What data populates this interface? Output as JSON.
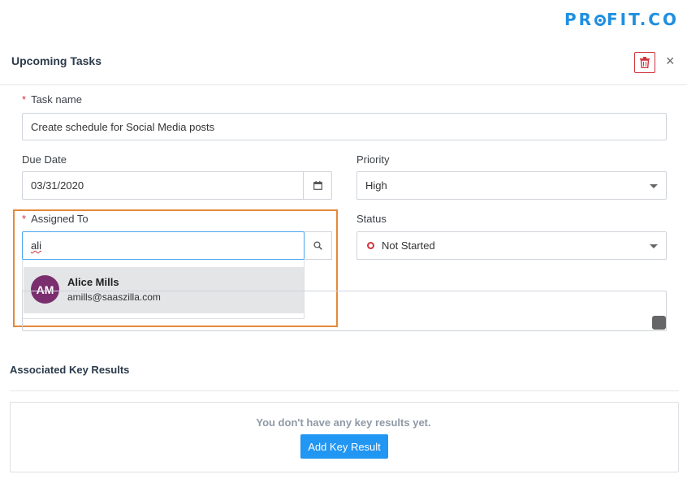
{
  "brand": {
    "logo_pre": "PR",
    "logo_post": "FIT.CO",
    "color": "#1f8fe0"
  },
  "header": {
    "title": "Upcoming Tasks",
    "delete_icon": "trash-icon",
    "close_label": "×"
  },
  "task_name": {
    "label": "Task name",
    "required": "*",
    "value": "Create schedule for Social Media posts"
  },
  "due_date": {
    "label": "Due Date",
    "value": "03/31/2020",
    "icon": "calendar-icon"
  },
  "priority": {
    "label": "Priority",
    "value": "High"
  },
  "assigned_to": {
    "label": "Assigned To",
    "required": "*",
    "query": "ali",
    "icon": "search-icon",
    "results": [
      {
        "initials": "AM",
        "name": "Alice Mills",
        "email": "amills@saaszilla.com",
        "avatar_color": "#7a2e6e"
      }
    ]
  },
  "status": {
    "label": "Status",
    "value": "Not Started",
    "dot_color": "#d0343c"
  },
  "key_results": {
    "title": "Associated Key Results",
    "empty_text": "You don't have any key results yet.",
    "add_label": "Add Key Result",
    "add_color": "#2196f3"
  }
}
